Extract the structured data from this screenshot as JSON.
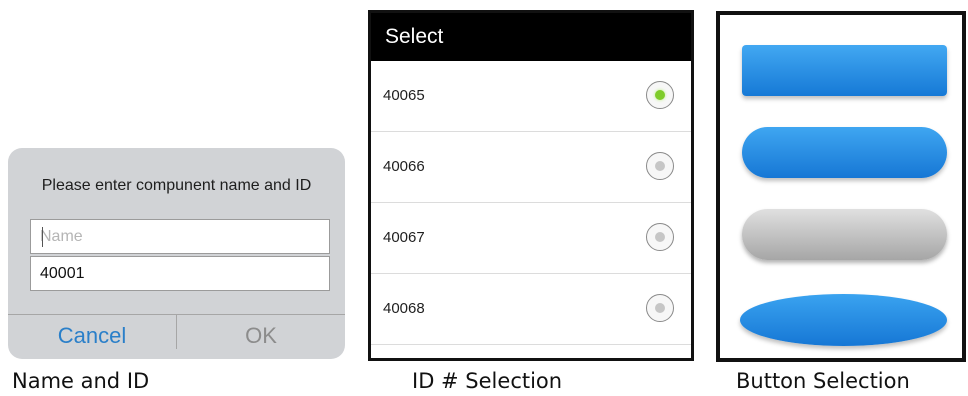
{
  "name_dialog": {
    "message": "Please enter compunent name and ID",
    "name_placeholder": "Name",
    "id_value": "40001",
    "cancel_label": "Cancel",
    "ok_label": "OK"
  },
  "id_select": {
    "title": "Select",
    "options": [
      {
        "label": "40065",
        "checked": true
      },
      {
        "label": "40066",
        "checked": false
      },
      {
        "label": "40067",
        "checked": false
      },
      {
        "label": "40068",
        "checked": false
      }
    ]
  },
  "button_styles": [
    {
      "name": "rounded-rectangle",
      "color": "#2a8fe6"
    },
    {
      "name": "pill",
      "color": "#2a8fe6"
    },
    {
      "name": "gray-pill",
      "color": "#bdbdbd"
    },
    {
      "name": "ellipse",
      "color": "#2a8fe6"
    }
  ],
  "captions": {
    "name_and_id": "Name and ID",
    "id_selection": "ID # Selection",
    "button_selection": "Button Selection"
  },
  "colors": {
    "link_blue": "#2a7fc9",
    "radio_selected": "#7fcc2a",
    "dialog_bg": "#d1d3d6"
  }
}
